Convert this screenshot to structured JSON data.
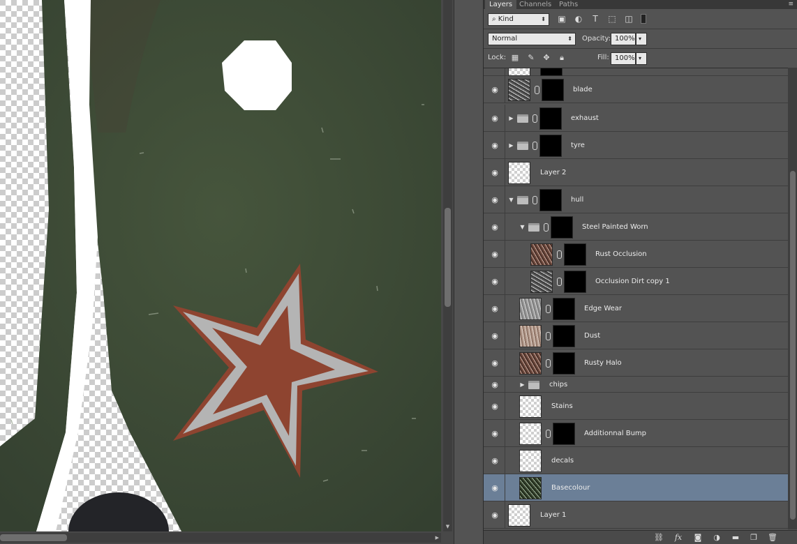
{
  "panel_tabs": [
    "Layers",
    "Channels",
    "Paths"
  ],
  "filter": {
    "kind_label": "Kind"
  },
  "blend": {
    "mode": "Normal",
    "opacity_label": "Opacity:",
    "opacity_value": "100%",
    "lock_label": "Lock:",
    "fill_label": "Fill:",
    "fill_value": "100%"
  },
  "layers": [
    {
      "name": "blade",
      "type": "layer",
      "thumb": "grunge",
      "mask": "blade",
      "selected": false
    },
    {
      "name": "exhaust",
      "type": "group",
      "expanded": false,
      "mask": "spots",
      "selected": false
    },
    {
      "name": "tyre",
      "type": "group",
      "expanded": false,
      "mask": "spots",
      "selected": false
    },
    {
      "name": "Layer 2",
      "type": "layer",
      "thumb": "transparent",
      "selected": false
    },
    {
      "name": "hull",
      "type": "group",
      "expanded": true,
      "mask": "white",
      "selected": false
    },
    {
      "name": "Steel Painted Worn",
      "type": "group",
      "expanded": true,
      "mask": "white",
      "selected": false
    },
    {
      "name": "Rust Occlusion",
      "type": "layer",
      "thumb": "rust",
      "mask": "noise",
      "selected": false
    },
    {
      "name": "Occlusion Dirt copy 1",
      "type": "layer",
      "thumb": "grunge",
      "mask": "noise",
      "selected": false
    },
    {
      "name": "Edge Wear",
      "type": "layer",
      "thumb": "grey",
      "mask": "black",
      "selected": false
    },
    {
      "name": "Dust",
      "type": "layer",
      "thumb": "dust",
      "mask": "black",
      "selected": false
    },
    {
      "name": "Rusty Halo",
      "type": "layer",
      "thumb": "rust",
      "mask": "noise",
      "selected": false
    },
    {
      "name": "chips",
      "type": "group",
      "expanded": false,
      "selected": false
    },
    {
      "name": "Stains",
      "type": "layer",
      "thumb": "transparent",
      "selected": false
    },
    {
      "name": "Additionnal Bump",
      "type": "layer",
      "thumb": "transparent",
      "mask": "black",
      "selected": false
    },
    {
      "name": "decals",
      "type": "layer",
      "thumb": "transparent",
      "selected": false
    },
    {
      "name": "Basecolour",
      "type": "layer",
      "thumb": "green",
      "selected": true
    },
    {
      "name": "Layer 1",
      "type": "layer",
      "thumb": "transparent",
      "selected": false
    }
  ],
  "colors": {
    "canvas_green": "#3f4d36",
    "star_fill": "#8e4430",
    "star_outline": "#b6b6b6",
    "selection": "#6b7f97"
  }
}
